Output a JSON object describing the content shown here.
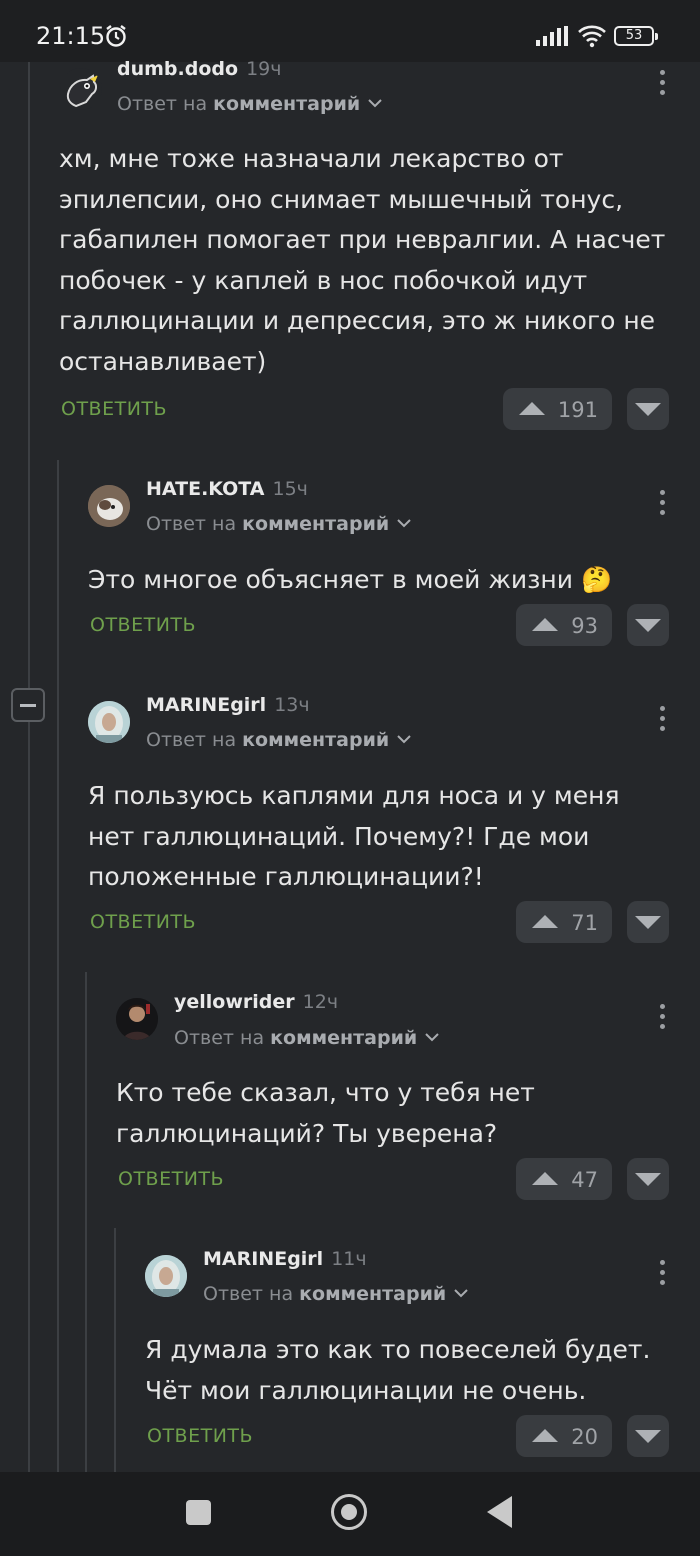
{
  "status_bar": {
    "time": "21:15",
    "battery": "53"
  },
  "labels": {
    "reply_prefix": "Ответ на",
    "reply_target": "комментарий",
    "reply_button": "ОТВЕТИТЬ"
  },
  "comments": [
    {
      "author": "dumb.dodo",
      "ago": "19ч",
      "text": "хм, мне тоже назначали лекарство от эпилепсии, оно снимает мышечный тонус, габапилен помогает при невралгии. А насчет побочек - у каплей в нос побочкой идут галлюцинации и депрессия, это ж никого не останавливает)",
      "rating": "191"
    },
    {
      "author": "HATE.KOTA",
      "ago": "15ч",
      "text": "Это многое объясняет в моей жизни 🤔",
      "rating": "93"
    },
    {
      "author": "MARINEgirl",
      "ago": "13ч",
      "text": "Я пользуюсь каплями для носа и у меня нет галлюцинаций. Почему?! Где мои положенные галлюцинации?!",
      "rating": "71"
    },
    {
      "author": "yellowrider",
      "ago": "12ч",
      "text": "Кто тебе сказал, что у тебя нет галлюцинаций? Ты уверена?",
      "rating": "47"
    },
    {
      "author": "MARINEgirl",
      "ago": "11ч",
      "text": "Я думала это как то повеселей будет. Чёт мои галлюцинации не очень.",
      "rating": "20"
    }
  ],
  "colors": {
    "background": "#25272a",
    "reply_green": "#6fa04c",
    "vote_bg": "#393c40"
  },
  "icons": [
    "alarm-icon",
    "signal-icon",
    "wifi-icon",
    "battery-icon",
    "kebab-menu-icon",
    "upvote-icon",
    "downvote-icon",
    "chevron-down-icon",
    "collapse-thread-icon",
    "nav-recents-icon",
    "nav-home-icon",
    "nav-back-icon"
  ]
}
